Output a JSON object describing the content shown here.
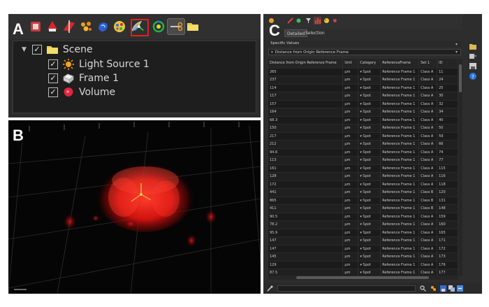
{
  "labels": {
    "a": "A",
    "b": "B",
    "c": "C"
  },
  "scene_tree": {
    "root": "Scene",
    "items": [
      "Light Source 1",
      "Frame 1",
      "Volume"
    ]
  },
  "toolbar_icons": [
    "new-scene-icon",
    "add-volume-icon",
    "add-clipping-plane-icon",
    "add-spots-icon",
    "add-surface-icon",
    "add-cells-icon",
    "add-filament-icon",
    "add-measurement-points-icon",
    "add-reference-frame-icon",
    "add-reference-frame-icon",
    "add-cross-icon",
    "scissors-icon",
    "folder-icon"
  ],
  "stats": {
    "tabs": [
      "Detailed",
      "Selection"
    ],
    "dropdown1": "Specific Values",
    "dropdown2": "Distance from Origin Reference Frame",
    "columns": [
      "Distance from Origin Reference Frame",
      "Unit",
      "Category",
      "ReferenceFrame",
      "Set 1",
      "ID"
    ],
    "rows": [
      [
        "265",
        "µm",
        "Spot",
        "Reference Frame 1",
        "Class A",
        "11"
      ],
      [
        "237",
        "µm",
        "Spot",
        "Reference Frame 1",
        "Class A",
        "24"
      ],
      [
        "114",
        "µm",
        "Spot",
        "Reference Frame 1",
        "Class A",
        "25"
      ],
      [
        "117",
        "µm",
        "Spot",
        "Reference Frame 1",
        "Class A",
        "30"
      ],
      [
        "157",
        "µm",
        "Spot",
        "Reference Frame 1",
        "Class A",
        "32"
      ],
      [
        "164",
        "µm",
        "Spot",
        "Reference Frame 1",
        "Class A",
        "34"
      ],
      [
        "68.3",
        "µm",
        "Spot",
        "Reference Frame 1",
        "Class A",
        "40"
      ],
      [
        "150",
        "µm",
        "Spot",
        "Reference Frame 1",
        "Class A",
        "50"
      ],
      [
        "217",
        "µm",
        "Spot",
        "Reference Frame 1",
        "Class A",
        "59"
      ],
      [
        "212",
        "µm",
        "Spot",
        "Reference Frame 1",
        "Class A",
        "66"
      ],
      [
        "94.6",
        "µm",
        "Spot",
        "Reference Frame 1",
        "Class A",
        "74"
      ],
      [
        "113",
        "µm",
        "Spot",
        "Reference Frame 1",
        "Class A",
        "77"
      ],
      [
        "161",
        "µm",
        "Spot",
        "Reference Frame 1",
        "Class A",
        "115"
      ],
      [
        "128",
        "µm",
        "Spot",
        "Reference Frame 1",
        "Class A",
        "116"
      ],
      [
        "172",
        "µm",
        "Spot",
        "Reference Frame 1",
        "Class A",
        "118"
      ],
      [
        "441",
        "µm",
        "Spot",
        "Reference Frame 1",
        "Class B",
        "120"
      ],
      [
        "865",
        "µm",
        "Spot",
        "Reference Frame 1",
        "Class B",
        "131"
      ],
      [
        "411",
        "µm",
        "Spot",
        "Reference Frame 1",
        "Class B",
        "148"
      ],
      [
        "90.5",
        "µm",
        "Spot",
        "Reference Frame 1",
        "Class A",
        "159"
      ],
      [
        "78.2",
        "µm",
        "Spot",
        "Reference Frame 1",
        "Class A",
        "160"
      ],
      [
        "95.9",
        "µm",
        "Spot",
        "Reference Frame 1",
        "Class A",
        "165"
      ],
      [
        "147",
        "µm",
        "Spot",
        "Reference Frame 1",
        "Class A",
        "171"
      ],
      [
        "147",
        "µm",
        "Spot",
        "Reference Frame 1",
        "Class A",
        "172"
      ],
      [
        "145",
        "µm",
        "Spot",
        "Reference Frame 1",
        "Class A",
        "173"
      ],
      [
        "129",
        "µm",
        "Spot",
        "Reference Frame 1",
        "Class A",
        "176"
      ],
      [
        "87.5",
        "µm",
        "Spot",
        "Reference Frame 1",
        "Class A",
        "177"
      ]
    ]
  },
  "colors": {
    "highlight": "#e02020",
    "volume_red": "#e01b1b",
    "folder": "#e8cf52"
  }
}
